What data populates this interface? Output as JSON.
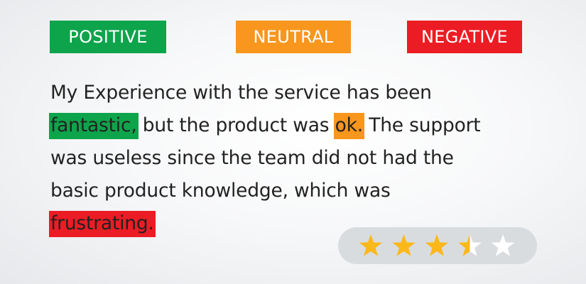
{
  "legend": {
    "positive": {
      "label": "POSITIVE",
      "color": "#0ea44b"
    },
    "neutral": {
      "label": "NEUTRAL",
      "color": "#f8961e"
    },
    "negative": {
      "label": "NEGATIVE",
      "color": "#ec1c24"
    }
  },
  "review": {
    "line1": "My Experience with the service has been",
    "positive_word": "fantastic,",
    "line2_mid": " but the product was ",
    "neutral_word": "ok.",
    "line2_end": " The support",
    "line3": "was useless since the team did not had the",
    "line4": "basic product knowledge, which was",
    "negative_word": "frustrating."
  },
  "rating": {
    "value": 3.5,
    "max": 5,
    "star_color": "#fbb81b",
    "empty_star_color": "#ffffff",
    "icon": "star-icon"
  }
}
